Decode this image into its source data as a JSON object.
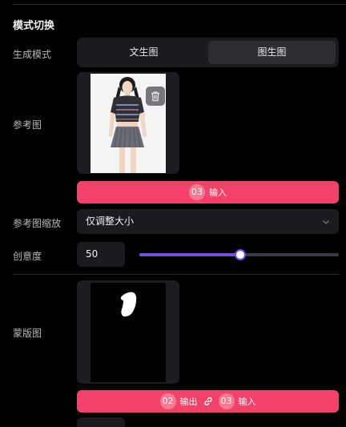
{
  "section": {
    "title": "模式切换"
  },
  "labels": {
    "mode": "生成模式",
    "reference": "参考图",
    "ref_scale": "参考图缩放",
    "creativity": "创意度",
    "mask": "蒙版图"
  },
  "mode_toggle": {
    "options": [
      "文生图",
      "图生图"
    ],
    "selected": "图生图"
  },
  "reference_input": {
    "badge": "03",
    "label": "输入"
  },
  "ref_scale_select": {
    "value": "仅调整大小"
  },
  "creativity": {
    "value": "50",
    "slider_fraction": 0.5
  },
  "mask_io": {
    "out_badge": "02",
    "out_label": "输出",
    "in_badge": "03",
    "in_label": "输入"
  },
  "icons": {
    "delete": "trash-icon",
    "link": "link-icon",
    "chevron": "chevron-down-icon"
  },
  "colors": {
    "accent_pink": "#f3426a",
    "slider_purple": "#7350e6",
    "background": "#000000",
    "panel": "#1a1b1f"
  }
}
